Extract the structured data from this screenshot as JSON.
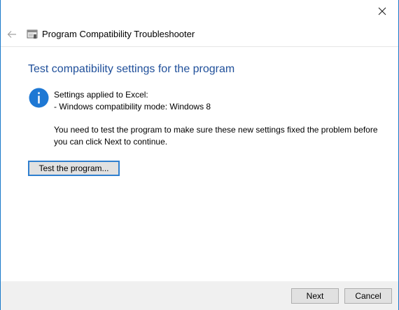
{
  "titlebar": {
    "close_icon": "close-icon"
  },
  "header": {
    "back_icon": "back-arrow-icon",
    "app_icon": "troubleshooter-icon",
    "title": "Program Compatibility Troubleshooter"
  },
  "main": {
    "heading": "Test compatibility settings for the program",
    "info_icon": "info-icon",
    "settings_line1": "Settings applied to Excel:",
    "settings_line2": "- Windows compatibility mode: Windows 8",
    "instruction": "You need to test the program to make sure these new settings fixed the problem before you can click Next to continue.",
    "test_button_label": "Test the program..."
  },
  "footer": {
    "next_label": "Next",
    "cancel_label": "Cancel"
  },
  "colors": {
    "heading": "#1f4f9a",
    "info_icon": "#1e78d4",
    "focus_border": "#2f7fcf",
    "footer_bg": "#f0f0f0"
  }
}
